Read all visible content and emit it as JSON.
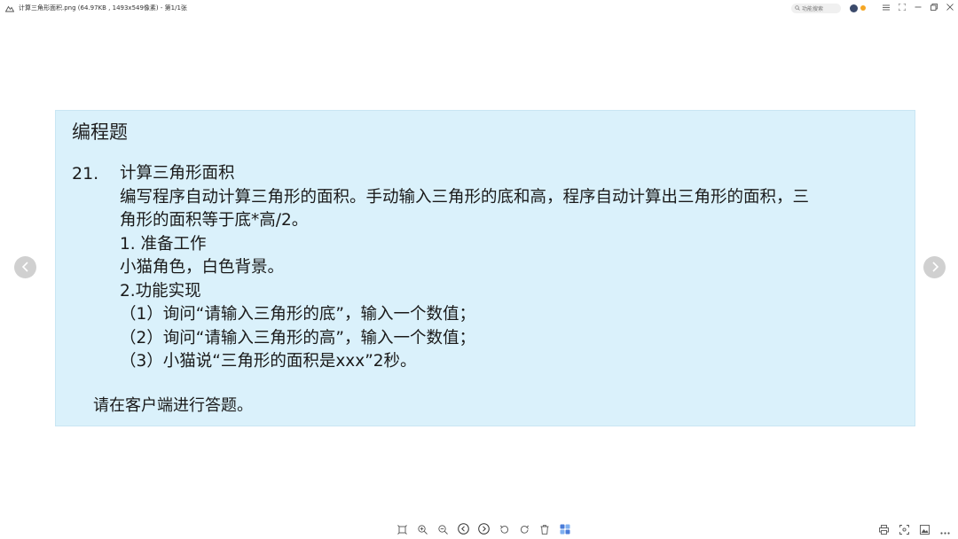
{
  "window": {
    "title": "计算三角形面积.png (64.97KB , 1493x549像素) - 第1/1张"
  },
  "search": {
    "placeholder": "功能搜索"
  },
  "image": {
    "heading": "编程题",
    "question_number": "21.",
    "lines": [
      "计算三角形面积",
      "编写程序自动计算三角形的面积。手动输入三角形的底和高，程序自动计算出三角形的面积，三",
      "角形的面积等于底*高/2。",
      "1. 准备工作",
      "小猫角色，白色背景。",
      "2.功能实现",
      "（1）询问“请输入三角形的底”，输入一个数值；",
      "（2）询问“请输入三角形的高”，输入一个数值；",
      "（3）小猫说“三角形的面积是xxx”2秒。"
    ],
    "footer": "请在客户端进行答题。"
  },
  "icons": {
    "app": "image-viewer-icon",
    "search": "search-icon",
    "menu": "menu-icon",
    "fullscreen": "fullscreen-icon",
    "restore": "restore-icon",
    "close": "close-icon",
    "prev": "chevron-left-icon",
    "next": "chevron-right-icon"
  },
  "colors": {
    "slide_bg": "#daf1fb",
    "nav_bg": "#d0d0d0",
    "accent": "#4a7cd9"
  }
}
